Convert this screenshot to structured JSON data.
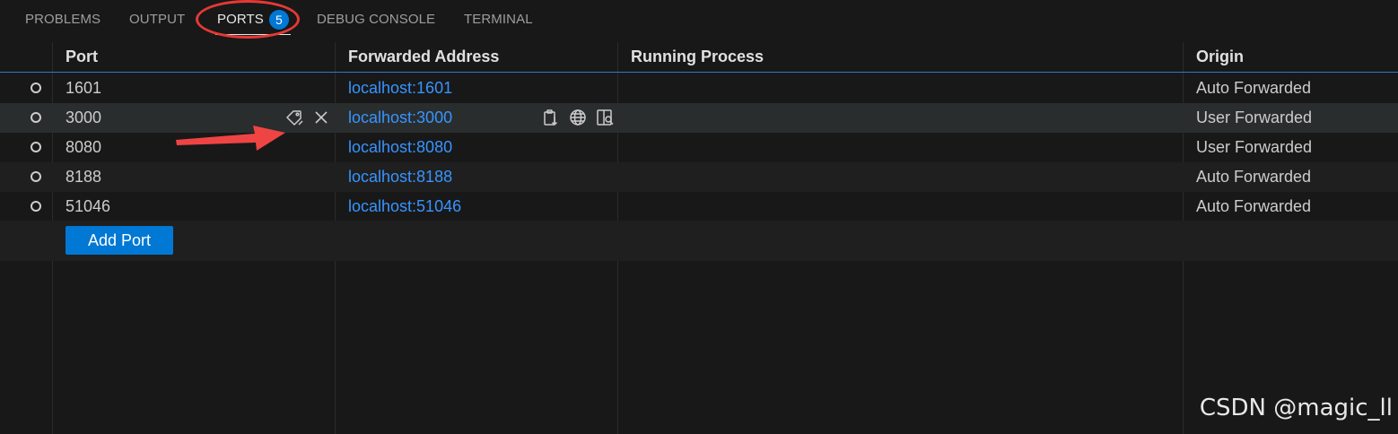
{
  "tabs": [
    {
      "label": "PROBLEMS",
      "active": false
    },
    {
      "label": "OUTPUT",
      "active": false
    },
    {
      "label": "PORTS",
      "active": true,
      "badge": "5"
    },
    {
      "label": "DEBUG CONSOLE",
      "active": false
    },
    {
      "label": "TERMINAL",
      "active": false
    }
  ],
  "table": {
    "columns": [
      "Port",
      "Forwarded Address",
      "Running Process",
      "Origin"
    ],
    "rows": [
      {
        "port": "1601",
        "address": "localhost:1601",
        "process": "",
        "origin": "Auto Forwarded"
      },
      {
        "port": "3000",
        "address": "localhost:3000",
        "process": "",
        "origin": "User Forwarded"
      },
      {
        "port": "8080",
        "address": "localhost:8080",
        "process": "",
        "origin": "User Forwarded"
      },
      {
        "port": "8188",
        "address": "localhost:8188",
        "process": "",
        "origin": "Auto Forwarded"
      },
      {
        "port": "51046",
        "address": "localhost:51046",
        "process": "",
        "origin": "Auto Forwarded"
      }
    ],
    "hovered_row_index": 1,
    "add_port_label": "Add Port"
  },
  "icons": {
    "port_actions": [
      "tag-icon",
      "close-icon"
    ],
    "address_actions": [
      "copy-address-icon",
      "globe-icon",
      "preview-icon"
    ]
  },
  "colors": {
    "accent": "#0078d4",
    "link": "#3794ff",
    "annotation": "#e53935"
  },
  "watermark": "CSDN @magic_ll"
}
